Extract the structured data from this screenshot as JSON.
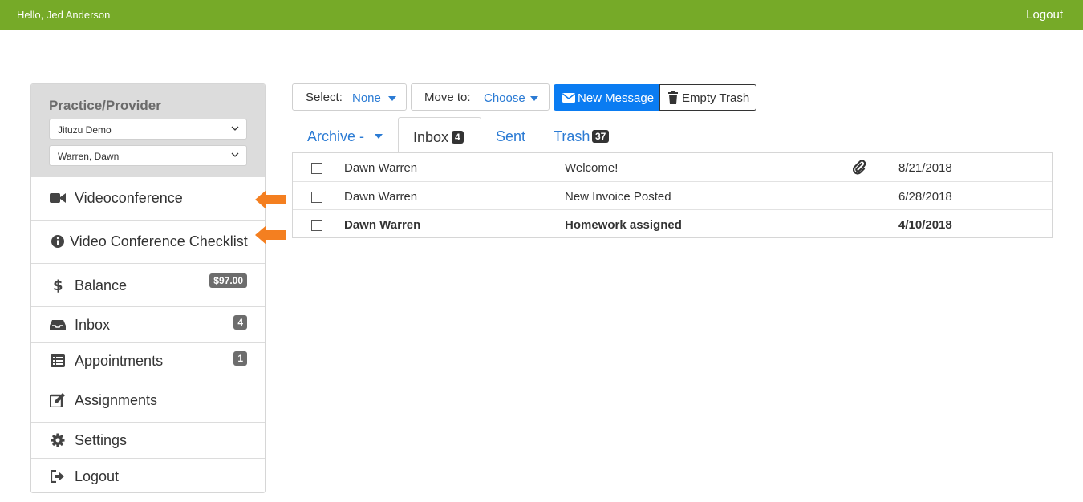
{
  "header": {
    "greeting": "Hello, Jed Anderson",
    "logout_label": "Logout",
    "bg_color": "#76aa28"
  },
  "sidebar": {
    "title": "Practice/Provider",
    "practice_select": "Jituzu Demo",
    "provider_select": "Warren, Dawn",
    "items": [
      {
        "label": "Videoconference",
        "icon": "video-camera-icon"
      },
      {
        "label": "Video Conference Checklist",
        "icon": "info-circle-icon"
      },
      {
        "label": "Balance",
        "icon": "dollar-icon",
        "badge": "$97.00"
      },
      {
        "label": "Inbox",
        "icon": "inbox-tray-icon",
        "badge": "4"
      },
      {
        "label": "Appointments",
        "icon": "list-icon",
        "badge": "1"
      },
      {
        "label": "Assignments",
        "icon": "edit-icon"
      },
      {
        "label": "Settings",
        "icon": "gear-icon"
      },
      {
        "label": "Logout",
        "icon": "sign-out-icon"
      }
    ]
  },
  "toolbar": {
    "select_label": "Select:",
    "select_value": "None",
    "move_label": "Move to:",
    "move_value": "Choose",
    "new_message_label": "New Message",
    "empty_trash_label": "Empty Trash"
  },
  "tabs": [
    {
      "label": "Archive -"
    },
    {
      "label": "Inbox",
      "badge": "4"
    },
    {
      "label": "Sent"
    },
    {
      "label": "Trash",
      "badge": "37"
    }
  ],
  "messages": [
    {
      "from": "Dawn Warren",
      "subject": "Welcome!",
      "date": "8/21/2018",
      "attachment": true,
      "unread": false
    },
    {
      "from": "Dawn Warren",
      "subject": "New Invoice Posted",
      "date": "6/28/2018",
      "attachment": false,
      "unread": false
    },
    {
      "from": "Dawn Warren",
      "subject": "Homework assigned",
      "date": "4/10/2018",
      "attachment": false,
      "unread": true
    }
  ],
  "colors": {
    "accent": "#2b7bd4",
    "primary_button": "#0a7cf2",
    "annotation_arrow": "#f47f20"
  }
}
